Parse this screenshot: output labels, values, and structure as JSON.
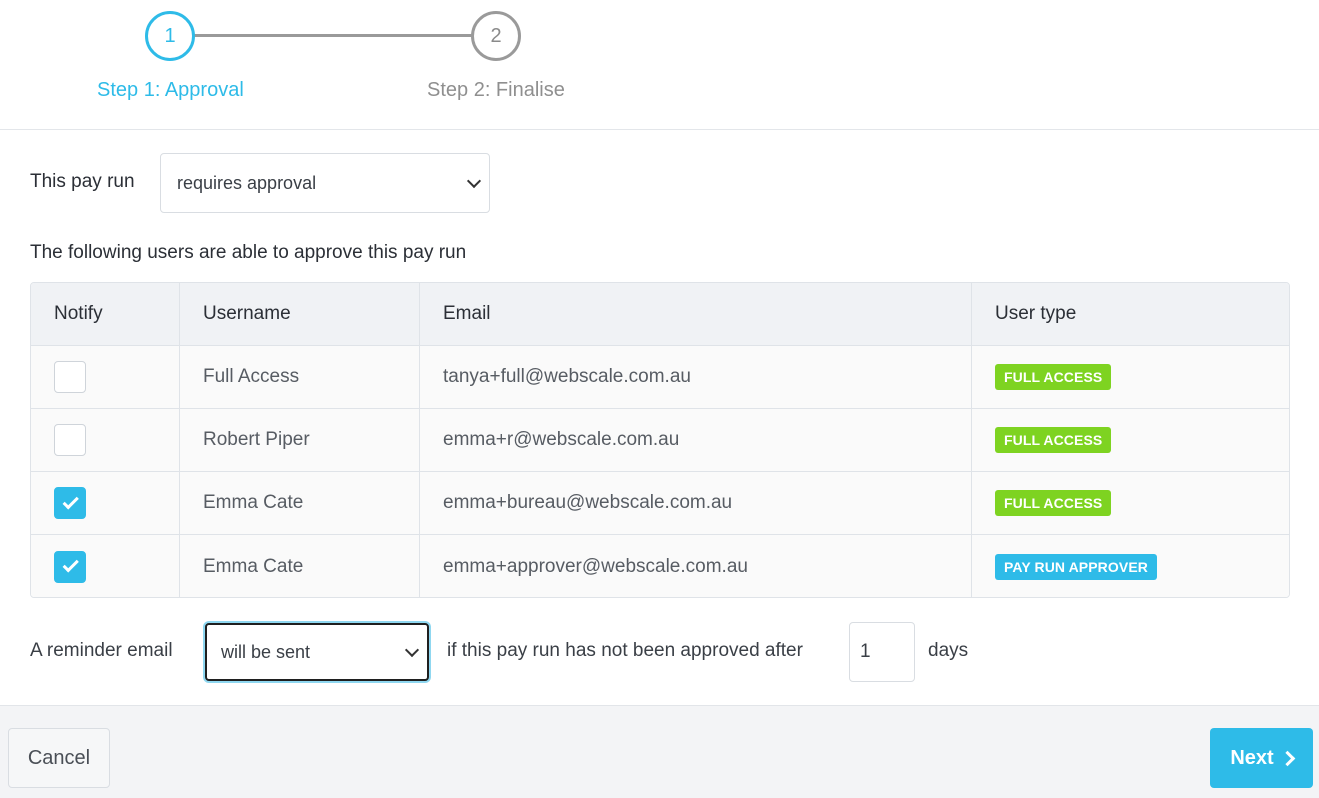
{
  "stepper": {
    "steps": [
      {
        "number": "1",
        "label": "Step 1: Approval",
        "state": "active"
      },
      {
        "number": "2",
        "label": "Step 2: Finalise",
        "state": "inactive"
      }
    ]
  },
  "payrun": {
    "label": "This pay run",
    "selected": "requires approval"
  },
  "approvers": {
    "heading": "The following users are able to approve this pay run",
    "columns": [
      "Notify",
      "Username",
      "Email",
      "User type"
    ],
    "rows": [
      {
        "notify": false,
        "username": "Full Access",
        "email": "tanya+full@webscale.com.au",
        "user_type": "FULL ACCESS",
        "badge_color": "#7ed321"
      },
      {
        "notify": false,
        "username": "Robert Piper",
        "email": "emma+r@webscale.com.au",
        "user_type": "FULL ACCESS",
        "badge_color": "#7ed321"
      },
      {
        "notify": true,
        "username": "Emma Cate",
        "email": "emma+bureau@webscale.com.au",
        "user_type": "FULL ACCESS",
        "badge_color": "#7ed321"
      },
      {
        "notify": true,
        "username": "Emma Cate",
        "email": "emma+approver@webscale.com.au",
        "user_type": "PAY RUN APPROVER",
        "badge_color": "#2ebbe8"
      }
    ]
  },
  "reminder": {
    "label": "A reminder email",
    "selected": "will be sent",
    "text": "if this pay run has not been approved after",
    "days_value": "1",
    "days_label": "days"
  },
  "footer": {
    "cancel_label": "Cancel",
    "next_label": "Next"
  },
  "colors": {
    "accent": "#2ebbe8",
    "full_access_badge": "#7ed321"
  }
}
